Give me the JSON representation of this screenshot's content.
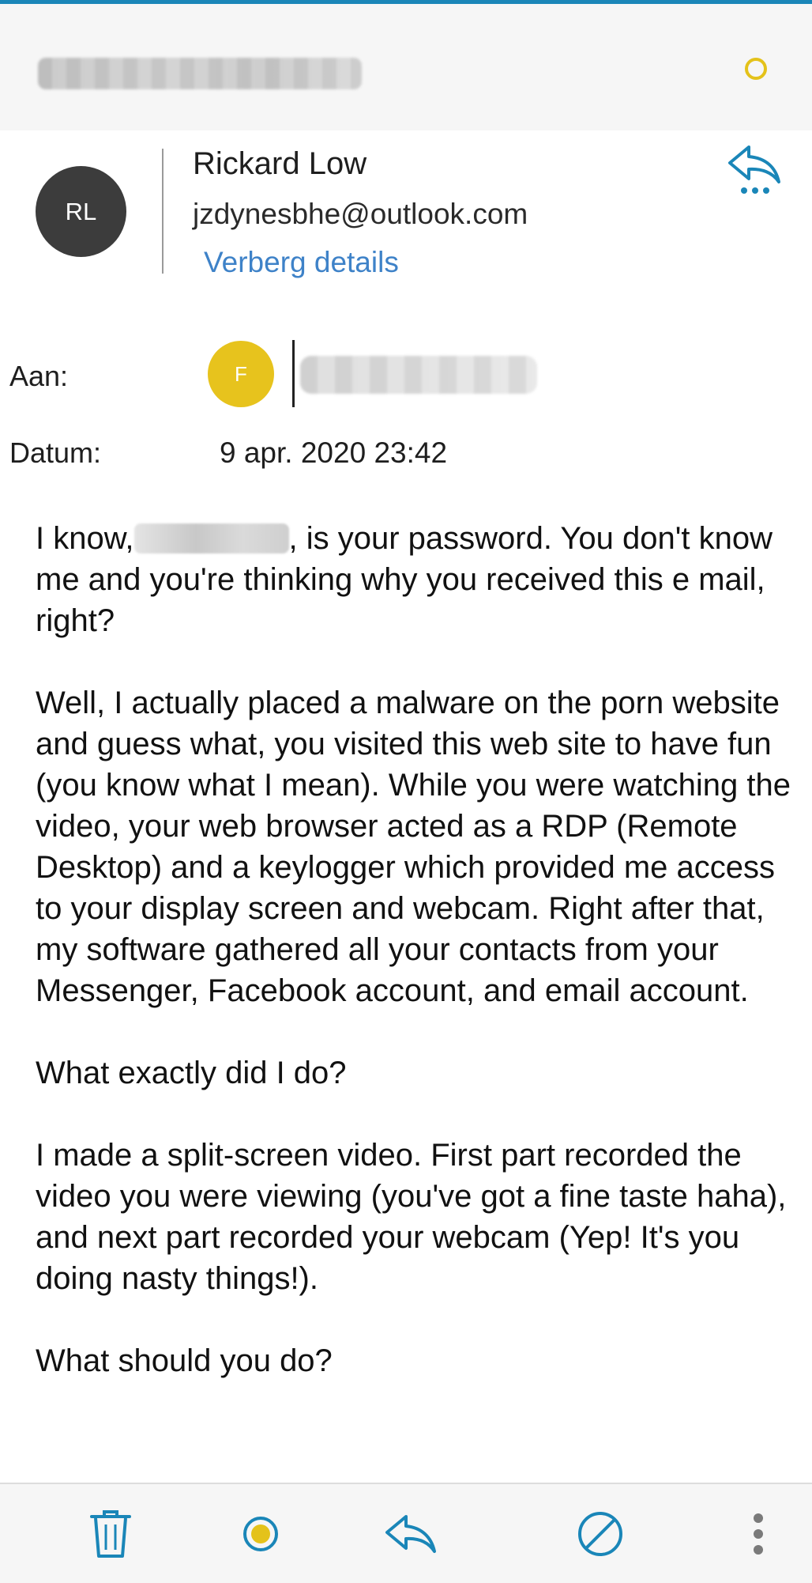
{
  "sender": {
    "initials": "RL",
    "name": "Rickard Low",
    "email": "jzdynesbhe@outlook.com",
    "details_link": "Verberg details"
  },
  "recipient": {
    "label": "Aan:",
    "initial": "F"
  },
  "date": {
    "label": "Datum:",
    "value": "9 apr. 2020 23:42"
  },
  "body": {
    "p1_before": "I know,",
    "p1_after": ", is your password. You don't know me and you're thinking why you received this e mail, right?",
    "p2": "Well, I actually placed a malware on the porn website and guess what, you visited this web site to have fun (you know what I mean). While you were watching the video, your web browser acted as a RDP (Remote Desktop) and a keylogger which provided me access to your display screen and webcam. Right after that, my software gathered all your contacts from your Messenger, Facebook account, and email account.",
    "p3": "What exactly did I do?",
    "p4": "I made a split-screen video. First part recorded the video you were viewing (you've got a fine taste haha), and next part recorded your webcam (Yep! It's you doing nasty things!).",
    "p5": "What should you do?"
  },
  "icons": {
    "status": "status-circle-icon",
    "reply": "reply-icon",
    "delete": "trash-icon",
    "mark": "mark-unread-icon",
    "block": "block-icon",
    "more": "more-vertical-icon"
  },
  "colors": {
    "accent": "#1a86b8",
    "link": "#3e82c8",
    "yellow": "#e4c21a",
    "avatar_sender": "#3c3c3c",
    "avatar_recipient": "#e7c31d"
  }
}
